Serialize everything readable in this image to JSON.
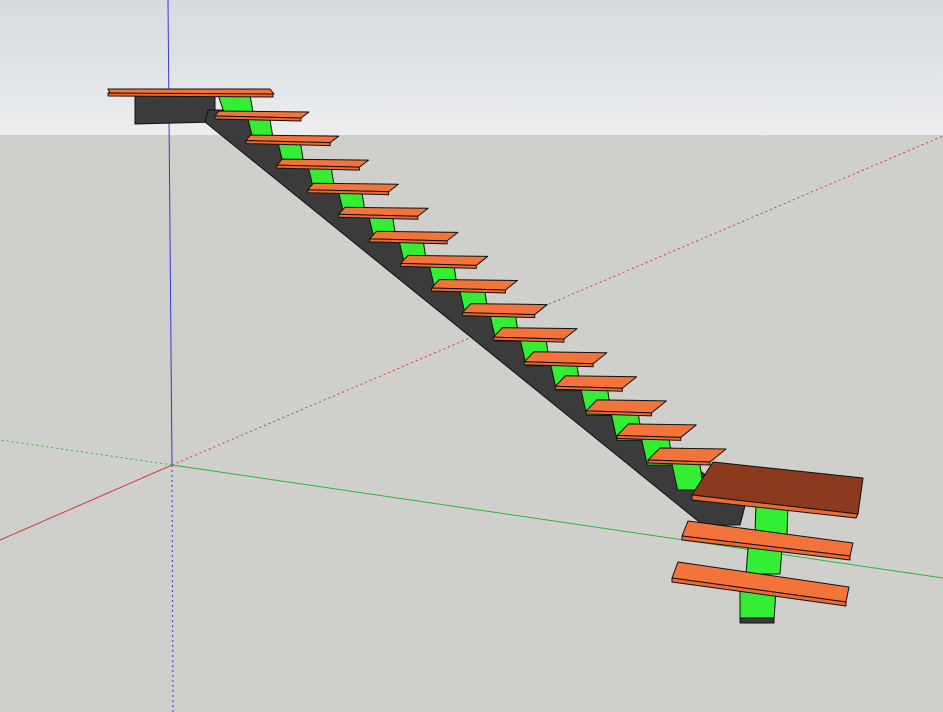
{
  "viewport": {
    "sky_top_color": "#d7dade",
    "sky_bottom_color": "#ebedef",
    "ground_color": "#cfcfcb"
  },
  "axes": {
    "red_color": "#d63a3a",
    "green_color": "#2db43a",
    "blue_color": "#3838d8"
  },
  "model": {
    "tread_top_color": "#f3733a",
    "tread_top_dark_color": "#8b3a1e",
    "tread_edge_color": "#e86a3a",
    "support_color": "#33ee33",
    "stringer_color": "#3b3b3b",
    "outline_color": "#111111",
    "tread_count": 15,
    "lower_tread_count": 2
  }
}
